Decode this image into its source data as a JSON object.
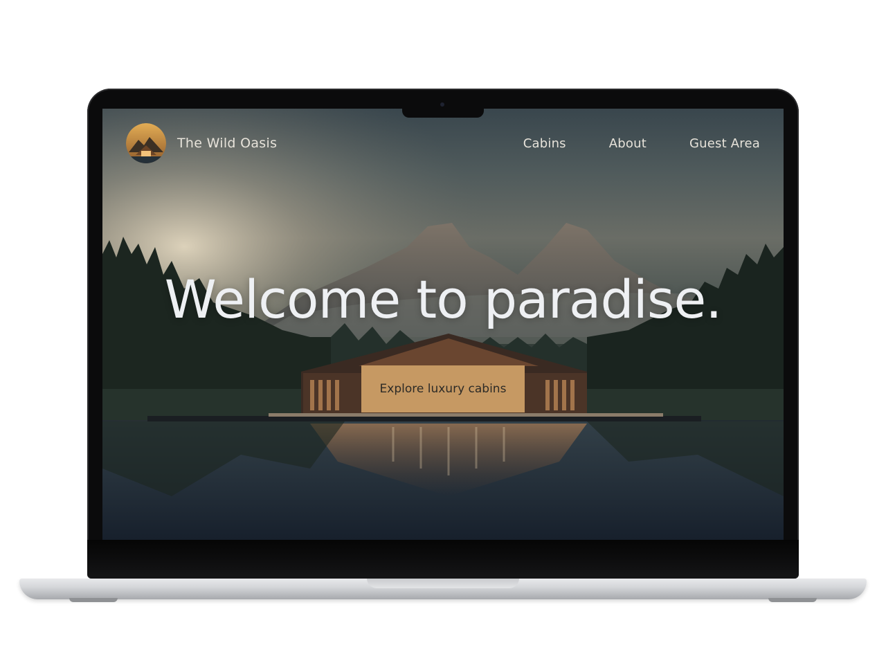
{
  "site": {
    "brand_name": "The Wild Oasis",
    "nav": [
      {
        "label": "Cabins"
      },
      {
        "label": "About"
      },
      {
        "label": "Guest Area"
      }
    ]
  },
  "hero": {
    "headline": "Welcome to paradise.",
    "cta_label": "Explore luxury cabins"
  },
  "colors": {
    "accent": "#c69963",
    "text_light": "#e7e3da",
    "headline": "#eef0f3",
    "laptop_bezel": "#0b0b0c",
    "laptop_base": "#d5d7da"
  },
  "icons": {
    "logo": "mountain-cabin-logo-icon"
  }
}
